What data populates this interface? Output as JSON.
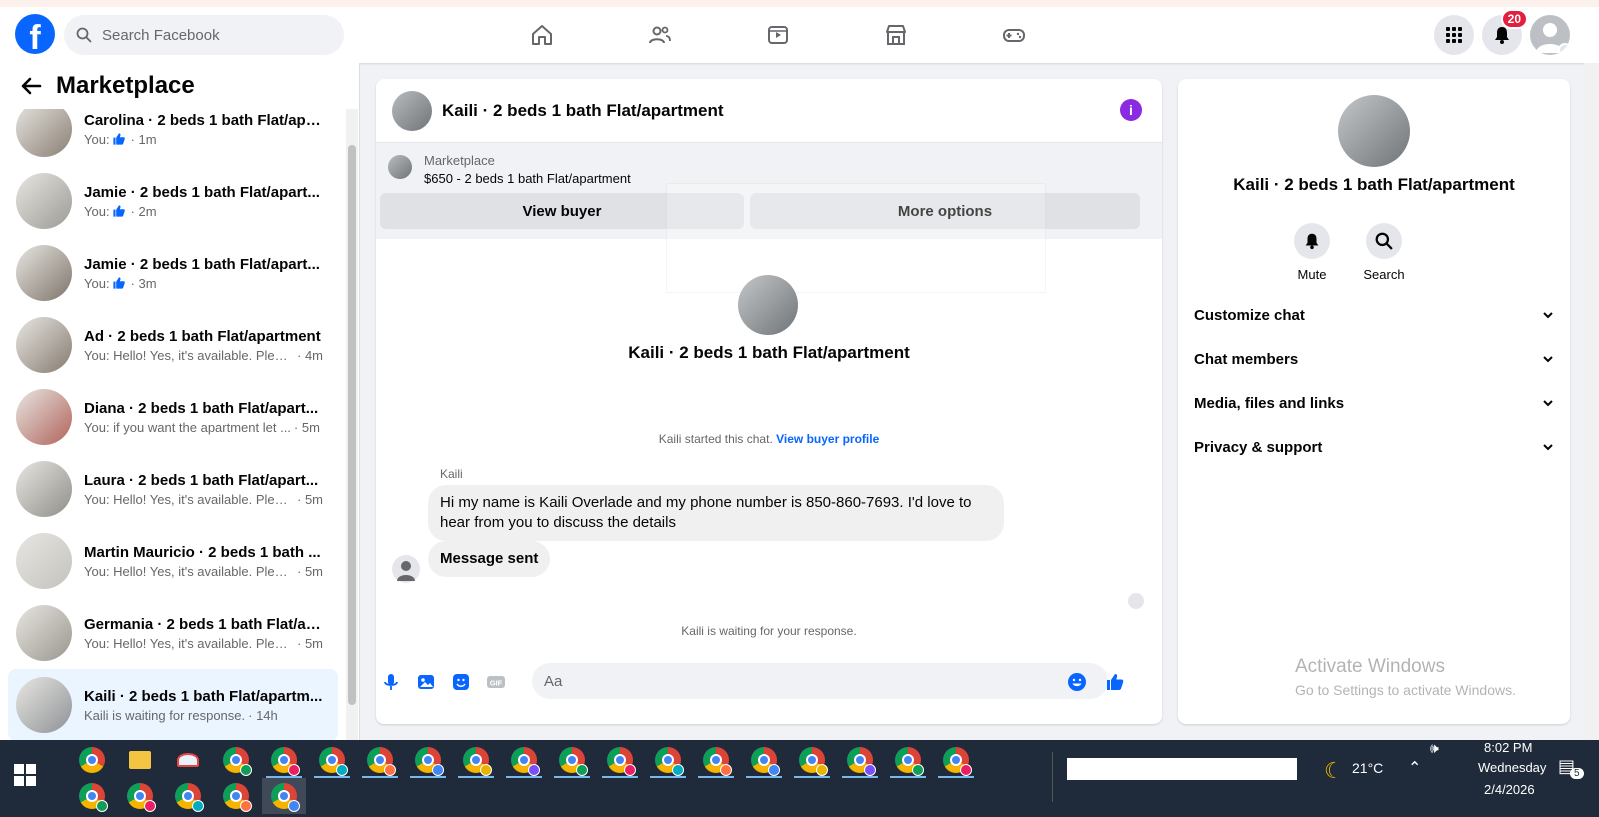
{
  "topbar": {
    "logo": "f",
    "search_placeholder": "Search Facebook",
    "notification_count": "20"
  },
  "sidebar": {
    "title": "Marketplace",
    "conversations": [
      {
        "name": "Carolina · 2 beds 1 bath Flat/apa...",
        "prefix": "You:",
        "snippet": "",
        "time": "· 1m",
        "thumb": "#8a7f73",
        "like": true
      },
      {
        "name": "Jamie · 2 beds 1 bath Flat/apart...",
        "prefix": "You:",
        "snippet": "",
        "time": "· 2m",
        "thumb": "#9c9a94",
        "like": true
      },
      {
        "name": "Jamie · 2 beds 1 bath Flat/apart...",
        "prefix": "You:",
        "snippet": "",
        "time": "· 3m",
        "thumb": "#7d746a",
        "like": true
      },
      {
        "name": "Ad · 2 beds 1 bath Flat/apartment",
        "prefix": "",
        "snippet": "You: Hello! Yes, it's available. Pleas...",
        "time": "· 4m",
        "thumb": "#857b70",
        "like": false
      },
      {
        "name": "Diana · 2 beds 1 bath Flat/apart...",
        "prefix": "",
        "snippet": "You: if you want the apartment let ...",
        "time": "· 5m",
        "thumb": "#b0635a",
        "like": false
      },
      {
        "name": "Laura · 2 beds 1 bath Flat/apart...",
        "prefix": "",
        "snippet": "You: Hello! Yes, it's available. Pleas...",
        "time": "· 5m",
        "thumb": "#8f8e88",
        "like": false
      },
      {
        "name": "Martin Mauricio · 2 beds 1 bath ...",
        "prefix": "",
        "snippet": "You: Hello! Yes, it's available. Pleas...",
        "time": "· 5m",
        "thumb": "#c4c2bc",
        "like": false
      },
      {
        "name": "Germania · 2 beds 1 bath Flat/ap...",
        "prefix": "",
        "snippet": "You: Hello! Yes, it's available. Pleas...",
        "time": "· 5m",
        "thumb": "#9a968e",
        "like": false
      },
      {
        "name": "Kaili · 2 beds 1 bath Flat/apartm...",
        "prefix": "",
        "snippet": "Kaili is waiting for response.",
        "time": "· 14h",
        "thumb": "#8e9296",
        "like": false
      }
    ]
  },
  "chat": {
    "title": "Kaili · 2 beds 1 bath Flat/apartment",
    "listing_label": "Marketplace",
    "listing_price": "$650 - 2 beds 1 bath Flat/apartment",
    "view_buyer": "View buyer",
    "more_options": "More options",
    "intro_title": "Kaili · 2 beds 1 bath Flat/apartment",
    "started_text": "Kaili started this chat.",
    "started_link": "View buyer profile",
    "sender": "Kaili",
    "message_1": "Hi my name is Kaili Overlade and my phone number is 850-860-7693. I'd love to hear from you to discuss the details",
    "message_2": "Message sent",
    "waiting": "Kaili is waiting for your response.",
    "input_placeholder": "Aa"
  },
  "info": {
    "title": "Kaili · 2 beds 1 bath Flat/apartment",
    "mute": "Mute",
    "search": "Search",
    "sections": [
      "Customize chat",
      "Chat members",
      "Media, files and links",
      "Privacy & support"
    ]
  },
  "watermark": {
    "line1": "Activate Windows",
    "line2": "Go to Settings to activate Windows."
  },
  "taskbar": {
    "temperature": "21°C",
    "time": "8:02 PM",
    "day": "Wednesday",
    "date": "2/4/2026",
    "notif_count": "5"
  },
  "colors": {
    "brand": "#0866ff",
    "accent_purple": "#8a2be2",
    "badge_red": "#e41e3f"
  }
}
